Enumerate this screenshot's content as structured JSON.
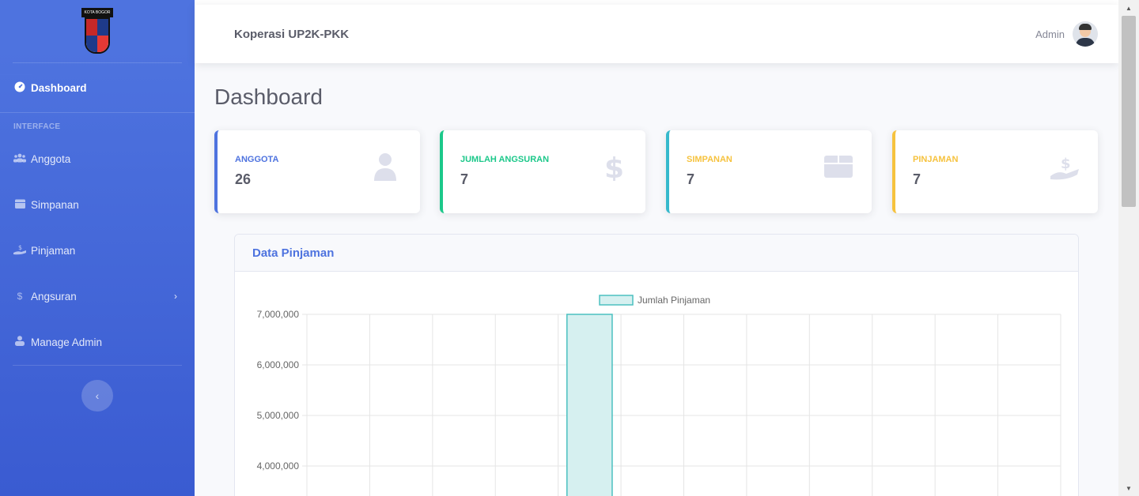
{
  "sidebar": {
    "logo_text": "KOTA BOGOR",
    "items": [
      {
        "label": "Dashboard",
        "icon": "tachometer-icon"
      },
      {
        "label": "Anggota",
        "icon": "users-icon"
      },
      {
        "label": "Simpanan",
        "icon": "calendar-icon"
      },
      {
        "label": "Pinjaman",
        "icon": "hand-dollar-icon"
      },
      {
        "label": "Angsuran",
        "icon": "dollar-icon"
      },
      {
        "label": "Manage Admin",
        "icon": "user-icon"
      }
    ],
    "heading": "INTERFACE",
    "toggle_glyph": "‹"
  },
  "topbar": {
    "title": "Koperasi UP2K-PKK",
    "user_name": "Admin"
  },
  "page": {
    "title": "Dashboard"
  },
  "cards": [
    {
      "label": "ANGGOTA",
      "value": "26",
      "color": "#4e73df"
    },
    {
      "label": "JUMLAH ANGSURAN",
      "value": "7",
      "color": "#1cc88a"
    },
    {
      "label": "SIMPANAN",
      "value": "7",
      "color": "#36b9cc"
    },
    {
      "label": "PINJAMAN",
      "value": "7",
      "color": "#f6c23e"
    }
  ],
  "chart_panel": {
    "title": "Data Pinjaman"
  },
  "chart_data": {
    "type": "bar",
    "categories": [
      "",
      "",
      "",
      "",
      "",
      "",
      "",
      "",
      "",
      "",
      "",
      ""
    ],
    "series": [
      {
        "name": "Jumlah Pinjaman",
        "values": [
          null,
          null,
          null,
          null,
          7000000,
          null,
          null,
          null,
          null,
          null,
          null,
          null
        ]
      }
    ],
    "ytick_labels": [
      "7,000,000",
      "6,000,000",
      "5,000,000",
      "4,000,000"
    ],
    "ylim_visible": [
      3650000,
      7000000
    ],
    "grid": true,
    "legend": "top-center",
    "colors": {
      "fill": "#d6f0f0",
      "stroke": "#4bc0c0"
    }
  }
}
